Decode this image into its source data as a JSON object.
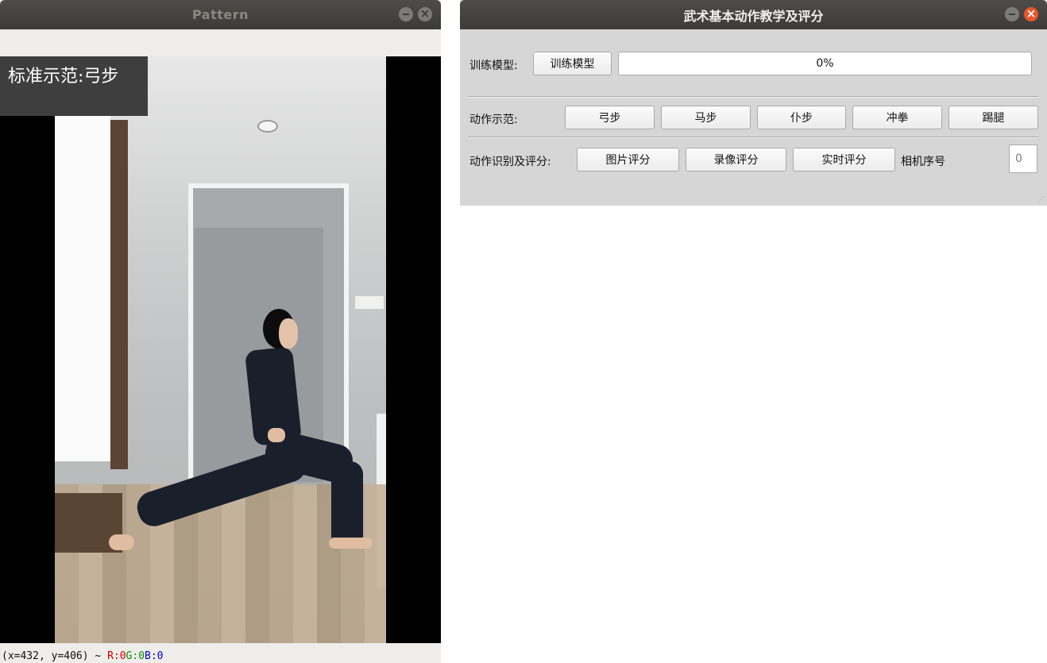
{
  "pattern_window": {
    "title": "Pattern",
    "overlay_label": "标准示范:弓步",
    "status": {
      "coords": "(x=432, y=406) ~ ",
      "r": "R:0",
      "g": "G:0",
      "b": "B:0"
    }
  },
  "main_window": {
    "title": "武术基本动作教学及评分",
    "train": {
      "label": "训练模型:",
      "button": "训练模型",
      "progress_text": "0%",
      "progress_value": 0
    },
    "demo": {
      "label": "动作示范:",
      "buttons": [
        "弓步",
        "马步",
        "仆步",
        "冲拳",
        "踢腿"
      ]
    },
    "scoring": {
      "label": "动作识别及评分:",
      "buttons": [
        "图片评分",
        "录像评分",
        "实时评分"
      ],
      "camera_label": "相机序号",
      "camera_index": "0"
    }
  },
  "colors": {
    "close_active": "#e9552a",
    "titlebar": "#3c3b37",
    "panel": "#d6d6d6"
  }
}
